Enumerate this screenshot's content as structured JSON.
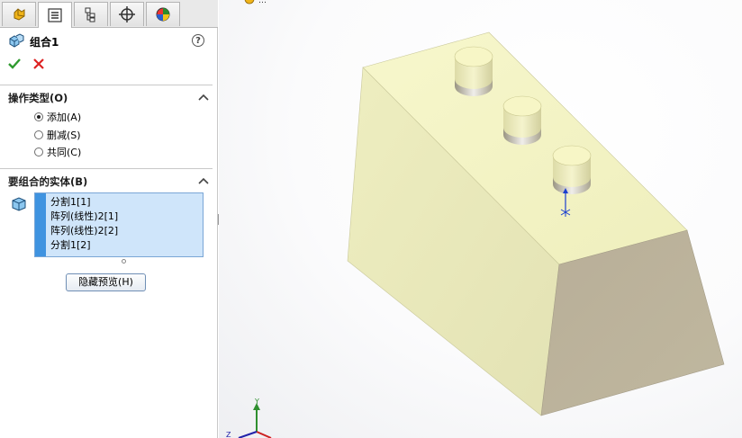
{
  "property_manager": {
    "tabs": [
      {
        "icon": "feature-manager-icon"
      },
      {
        "icon": "property-manager-icon"
      },
      {
        "icon": "configuration-manager-icon"
      },
      {
        "icon": "dimxpert-manager-icon"
      },
      {
        "icon": "display-manager-icon"
      }
    ],
    "feature_title": "组合1",
    "help_label": "?",
    "operation_type": {
      "header": "操作类型(O)",
      "options": [
        {
          "label": "添加(A)",
          "selected": true
        },
        {
          "label": "删减(S)",
          "selected": false
        },
        {
          "label": "共同(C)",
          "selected": false
        }
      ]
    },
    "bodies_to_combine": {
      "header": "要组合的实体(B)",
      "items": [
        "分割1[1]",
        "阵列(线性)2[1]",
        "阵列(线性)2[2]",
        "分割1[2]"
      ]
    },
    "hide_preview_button": "隐藏预览(H)"
  },
  "viewport": {
    "title_fragment": "…",
    "triad": {
      "y_label": "Y",
      "z_label": "Z"
    }
  },
  "colors": {
    "model_top": "#f3f3c2",
    "model_front": "#b9b29a",
    "model_left": "#e9e9b9",
    "selection_bg": "#cfe5fa",
    "selection_bar": "#3f93e0"
  }
}
